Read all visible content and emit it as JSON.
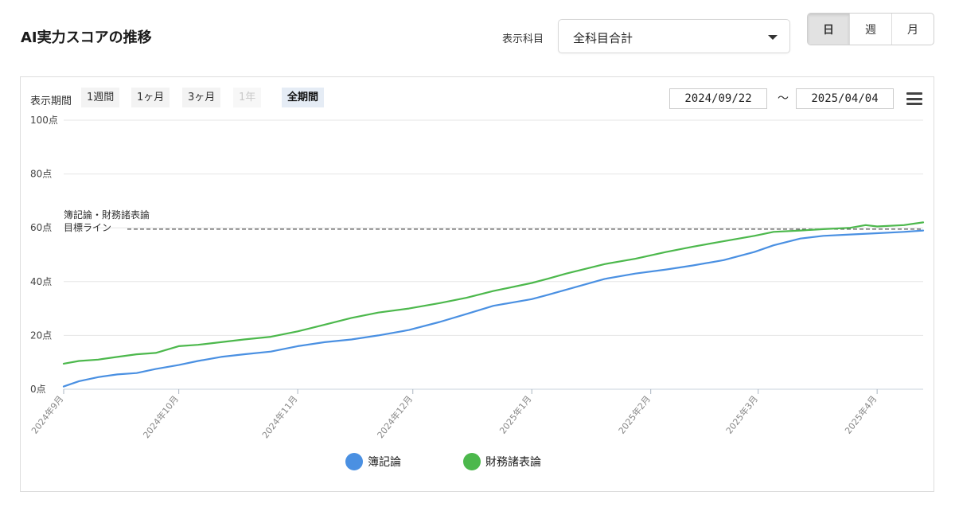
{
  "header": {
    "title": "AI実力スコアの推移"
  },
  "subject": {
    "label": "表示科目",
    "selected": "全科目合計"
  },
  "granularity": {
    "options": [
      "日",
      "週",
      "月"
    ],
    "active": "日"
  },
  "period": {
    "label": "表示期間",
    "buttons": [
      "1週間",
      "1ヶ月",
      "3ヶ月",
      "1年",
      "全期間"
    ],
    "disabled": "1年",
    "active": "全期間",
    "start_date": "2024/09/22",
    "end_date": "2025/04/04",
    "separator": "〜"
  },
  "colors": {
    "series1": "#4a90e2",
    "series2": "#4cb84c",
    "target": "#555555",
    "grid": "#e6e6e6"
  },
  "chart_data": {
    "type": "line",
    "yticks": [
      "0点",
      "20点",
      "40点",
      "60点",
      "80点",
      "100点"
    ],
    "ylim": [
      0,
      100
    ],
    "x_range": [
      "2024-09-01",
      "2025-04-13"
    ],
    "xticks": [
      {
        "label": "2024年9月",
        "date": "2024-09-01"
      },
      {
        "label": "2024年10月",
        "date": "2024-10-01"
      },
      {
        "label": "2024年11月",
        "date": "2024-11-01"
      },
      {
        "label": "2024年12月",
        "date": "2024-12-01"
      },
      {
        "label": "2025年1月",
        "date": "2025-01-01"
      },
      {
        "label": "2025年2月",
        "date": "2025-02-01"
      },
      {
        "label": "2025年3月",
        "date": "2025-03-01"
      },
      {
        "label": "2025年4月",
        "date": "2025-04-01"
      }
    ],
    "target": {
      "value": 59.5,
      "label_line1": "簿記論・財務諸表論",
      "label_line2": "目標ライン"
    },
    "series": [
      {
        "name": "簿記論",
        "points": [
          [
            "2024-09-01",
            1
          ],
          [
            "2024-09-05",
            3
          ],
          [
            "2024-09-10",
            4.5
          ],
          [
            "2024-09-15",
            5.5
          ],
          [
            "2024-09-20",
            6
          ],
          [
            "2024-09-25",
            7.5
          ],
          [
            "2024-10-01",
            9
          ],
          [
            "2024-10-06",
            10.5
          ],
          [
            "2024-10-12",
            12
          ],
          [
            "2024-10-18",
            13
          ],
          [
            "2024-10-25",
            14
          ],
          [
            "2024-11-01",
            16
          ],
          [
            "2024-11-08",
            17.5
          ],
          [
            "2024-11-15",
            18.5
          ],
          [
            "2024-11-22",
            20
          ],
          [
            "2024-11-30",
            22
          ],
          [
            "2024-12-08",
            25
          ],
          [
            "2024-12-15",
            28
          ],
          [
            "2024-12-22",
            31
          ],
          [
            "2025-01-01",
            33.5
          ],
          [
            "2025-01-05",
            35
          ],
          [
            "2025-01-10",
            37
          ],
          [
            "2025-01-20",
            41
          ],
          [
            "2025-01-28",
            43
          ],
          [
            "2025-02-05",
            44.5
          ],
          [
            "2025-02-12",
            46
          ],
          [
            "2025-02-20",
            48
          ],
          [
            "2025-02-28",
            51
          ],
          [
            "2025-03-05",
            53.5
          ],
          [
            "2025-03-12",
            56
          ],
          [
            "2025-03-18",
            57
          ],
          [
            "2025-03-25",
            57.5
          ],
          [
            "2025-04-01",
            58
          ],
          [
            "2025-04-08",
            58.5
          ],
          [
            "2025-04-13",
            59
          ]
        ]
      },
      {
        "name": "財務諸表論",
        "points": [
          [
            "2024-09-01",
            9.5
          ],
          [
            "2024-09-05",
            10.5
          ],
          [
            "2024-09-10",
            11
          ],
          [
            "2024-09-15",
            12
          ],
          [
            "2024-09-20",
            13
          ],
          [
            "2024-09-25",
            13.5
          ],
          [
            "2024-10-01",
            16
          ],
          [
            "2024-10-06",
            16.5
          ],
          [
            "2024-10-12",
            17.5
          ],
          [
            "2024-10-18",
            18.5
          ],
          [
            "2024-10-25",
            19.5
          ],
          [
            "2024-11-01",
            21.5
          ],
          [
            "2024-11-08",
            24
          ],
          [
            "2024-11-15",
            26.5
          ],
          [
            "2024-11-22",
            28.5
          ],
          [
            "2024-11-30",
            30
          ],
          [
            "2024-12-08",
            32
          ],
          [
            "2024-12-15",
            34
          ],
          [
            "2024-12-22",
            36.5
          ],
          [
            "2025-01-01",
            39.5
          ],
          [
            "2025-01-05",
            41
          ],
          [
            "2025-01-10",
            43
          ],
          [
            "2025-01-20",
            46.5
          ],
          [
            "2025-01-28",
            48.5
          ],
          [
            "2025-02-05",
            51
          ],
          [
            "2025-02-12",
            53
          ],
          [
            "2025-02-20",
            55
          ],
          [
            "2025-02-28",
            57
          ],
          [
            "2025-03-05",
            58.5
          ],
          [
            "2025-03-12",
            59
          ],
          [
            "2025-03-18",
            59.5
          ],
          [
            "2025-03-25",
            60
          ],
          [
            "2025-03-29",
            61
          ],
          [
            "2025-04-01",
            60.5
          ],
          [
            "2025-04-08",
            61
          ],
          [
            "2025-04-13",
            62
          ]
        ]
      }
    ]
  }
}
